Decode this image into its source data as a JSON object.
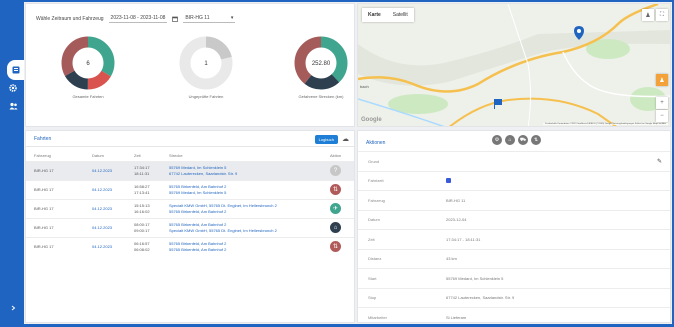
{
  "filter": {
    "label": "Wähle Zeitraum und Fahrzeug",
    "date_range": "2023-11-08 - 2023-11-08",
    "vehicle": "BIR-HG 11",
    "vehicle_caret": "▾"
  },
  "stats": [
    {
      "value": "6",
      "label": "Gesamte Fahrten"
    },
    {
      "value": "1",
      "label": "Ungeprüfte Fahrten"
    },
    {
      "value": "252.80",
      "label": "Gefahrene Strecken (km)"
    }
  ],
  "map": {
    "tab_map": "Karte",
    "tab_sat": "Satellit",
    "place_label": "bach",
    "google": "Google",
    "attribution": "Kurzbefehle  Kartendaten ©2023 GeoBasis-DE/BKG (©2009) Google  Nutzungsbedingungen  Fehler bei Google Maps melden",
    "zoom_in": "+",
    "zoom_out": "−",
    "colors": {
      "water": "#aadaff",
      "road": "#f6c04e",
      "land": "#eef0ea",
      "green": "#cde9c2"
    }
  },
  "trips": {
    "title": "Fahrten",
    "export": "Logbuch",
    "columns": [
      "Fahrzeug",
      "Datum",
      "Zeit",
      "Strecke",
      "Aktion"
    ],
    "rows": [
      {
        "vehicle": "BIR-HG 17",
        "date": "04.12.2023",
        "time1": "17:34:17",
        "time2": "18:11:31",
        "route1": "55769 Medard, Im Schlenklein 5",
        "route2": "67742 Lauterecken, Saarlandstr. Str. 9",
        "icon": "?",
        "color": "#c7c7c7"
      },
      {
        "vehicle": "BIR-HG 17",
        "date": "04.12.2023",
        "time1": "16:58:27",
        "time2": "17:13:41",
        "route1": "55765 Birkenfeld, Am Bahnhof 2",
        "route2": "55769 Medard, Im Schlenklein 5",
        "icon": "⇅",
        "color": "#b15a5a"
      },
      {
        "vehicle": "BIR-HG 17",
        "date": "04.12.2023",
        "time1": "15:15:13",
        "time2": "16:16:02",
        "route1": "Specialt KMW GmbH, 55765 Dt. Englnet, Im Hellersbrunch 2",
        "route2": "55765 Birkenfeld, Am Bahnhof 2",
        "icon": "✈",
        "color": "#3fa58f"
      },
      {
        "vehicle": "BIR-HG 17",
        "date": "04.12.2023",
        "time1": "08:00:17",
        "time2": "09:00:17",
        "route1": "55765 Birkenfeld, Am Bahnhof 2",
        "route2": "Specialt KMW GmbH, 55765 Dt. Englnet, Im Hellersbrunch 2",
        "icon": "⌂",
        "color": "#2e3f4f"
      },
      {
        "vehicle": "BIR-HG 17",
        "date": "04.12.2023",
        "time1": "06:16:57",
        "time2": "06:08:02",
        "route1": "55765 Birkenfeld, Am Bahnhof 2",
        "route2": "55765 Birkenfeld, Am Bahnhof 2",
        "icon": "⇅",
        "color": "#b15a5a"
      }
    ]
  },
  "details": {
    "title": "Aktionen",
    "edit_icon": "✎",
    "fields": [
      {
        "key": "Grund",
        "value": ""
      },
      {
        "key": "Fahrtzeit",
        "value": "",
        "checkbox": true
      },
      {
        "key": "Fahrzeug",
        "value": "BIR-HG 11"
      },
      {
        "key": "Datum",
        "value": "2023-12-04"
      },
      {
        "key": "Zeit",
        "value": "17:34:17 - 18:11:31"
      },
      {
        "key": "Distanz",
        "value": "43 km"
      },
      {
        "key": "Start",
        "value": "55769 Medard, Im Schlenklein 5"
      },
      {
        "key": "Stop",
        "value": "67742 Lauterecken, Saarlandstr. Str. 9"
      },
      {
        "key": "Mitarbeiter",
        "value": "Si Lieferam"
      }
    ]
  },
  "colors": {
    "brand": "#1f64c0",
    "teal": "#3fa58f",
    "red": "#d9534f",
    "brown": "#a65b5b",
    "navy": "#2e3f4f",
    "grey": "#cccccc"
  }
}
